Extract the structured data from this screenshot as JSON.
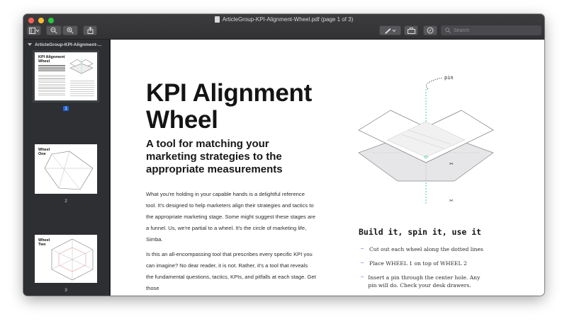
{
  "window": {
    "title": "ArticleGroup-KPI-Alignment-Wheel.pdf (page 1 of 3)"
  },
  "toolbar": {
    "search_placeholder": "Search"
  },
  "sidebar": {
    "file_name": "ArticleGroup-KPI-Alignment-...",
    "pages": [
      {
        "number": "1",
        "selected": true
      },
      {
        "number": "2",
        "selected": false
      },
      {
        "number": "3",
        "selected": false
      }
    ],
    "thumb_titles": [
      "KPI Alignment Wheel",
      "Wheel One",
      "Wheel Two"
    ]
  },
  "document": {
    "title": "KPI Alignment Wheel",
    "subtitle": "A tool for matching your marketing strategies to the appropriate measurements",
    "para1": "What you're holding in your capable hands is a delightful reference tool. It's designed to help marketers align their strategies and tactics to the appropriate marketing stage. Some might suggest these stages are a funnel. Us, we're partial to a wheel. It's the circle of marketing life, Simba.",
    "para2": "Is this an all-encompassing tool that prescribes every specific KPI you can imagine? No dear reader, it is not. Rather, it's a tool that reveals the fundamental questions, tactics, KPIs, and pitfalls at each stage. Get those",
    "pin_label": "pin",
    "build_title": "Build it, spin it, use it",
    "steps": [
      "Cut out each wheel along the dotted lines",
      "Place WHEEL 1 on top of WHEEL 2",
      "Insert a pin through the center hole. Any pin will do. Check your desk drawers."
    ],
    "step_mark": "~"
  },
  "colors": {
    "accent_purple": "#a065d8",
    "guide_teal": "#4cc7b0",
    "selection_blue": "#1f62d6"
  }
}
